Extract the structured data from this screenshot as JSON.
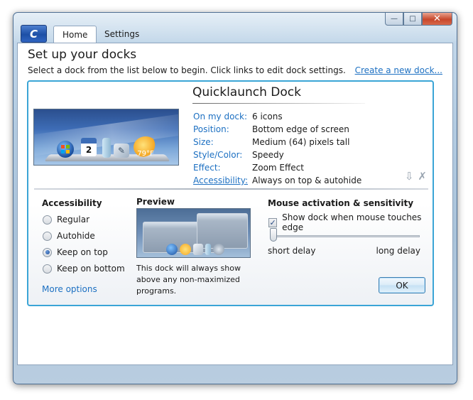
{
  "window": {
    "app_logo": "C",
    "tabs": [
      {
        "label": "Home",
        "active": true
      },
      {
        "label": "Settings",
        "active": false
      }
    ],
    "caption": {
      "minimize": "—",
      "maximize": "□",
      "close": "✕"
    }
  },
  "header": {
    "title": "Set up your docks",
    "subtitle": "Select a dock from the list below to begin. Click links to edit dock settings.",
    "create_link": "Create a new dock..."
  },
  "dock": {
    "name": "Quicklaunch Dock",
    "thumbnail": {
      "calendar_day": "2",
      "weather_temp": "79°F",
      "icons": [
        "windows-orb-icon",
        "calendar-icon",
        "bottle-icon",
        "pen-icon",
        "weather-icon"
      ]
    },
    "properties": [
      {
        "label": "On my dock:",
        "value": "6 icons",
        "linked": false
      },
      {
        "label": "Position:",
        "value": "Bottom edge of screen",
        "linked": false
      },
      {
        "label": "Size:",
        "value": "Medium (64) pixels tall",
        "linked": false
      },
      {
        "label": "Style/Color:",
        "value": "Speedy",
        "linked": false
      },
      {
        "label": "Effect:",
        "value": "Zoom Effect",
        "linked": false
      },
      {
        "label": "Accessibility:",
        "value": "Always on top & autohide",
        "linked": true
      }
    ],
    "edge_icons": [
      "download-icon",
      "delete-icon"
    ]
  },
  "accessibility": {
    "title": "Accessibility",
    "options": [
      {
        "label": "Regular",
        "checked": false
      },
      {
        "label": "Autohide",
        "checked": false
      },
      {
        "label": "Keep on top",
        "checked": true
      },
      {
        "label": "Keep on bottom",
        "checked": false
      }
    ],
    "more_options": "More options"
  },
  "preview": {
    "title": "Preview",
    "description": "This dock will always show above any non-maximized programs."
  },
  "mouse": {
    "title": "Mouse activation & sensitivity",
    "checkbox_label": "Show dock when mouse touches edge",
    "checkbox_checked": true,
    "slider_min_label": "short delay",
    "slider_max_label": "long delay",
    "slider_value_fraction": 0.0
  },
  "ok_label": "OK",
  "colors": {
    "accent": "#3ba5d6",
    "link": "#1d70c2"
  }
}
